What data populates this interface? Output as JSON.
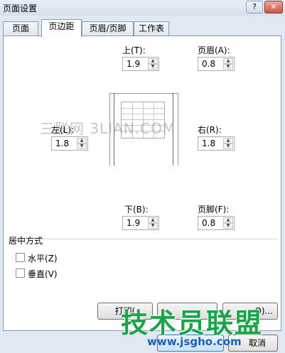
{
  "window": {
    "title": "页面设置",
    "help_label": "?",
    "close_label": "✕"
  },
  "tabs": [
    {
      "label": "页面"
    },
    {
      "label": "页边距",
      "active": true
    },
    {
      "label": "页眉/页脚"
    },
    {
      "label": "工作表"
    }
  ],
  "margins": {
    "top_label": "上(T):",
    "top_value": "1.9",
    "header_label": "页眉(A):",
    "header_value": "0.8",
    "left_label": "左(L):",
    "left_value": "1.8",
    "right_label": "右(R):",
    "right_value": "1.8",
    "bottom_label": "下(B):",
    "bottom_value": "1.9",
    "footer_label": "页脚(F):",
    "footer_value": "0.8"
  },
  "center": {
    "group_label": "居中方式",
    "horizontal_label": "水平(Z)",
    "horizontal_checked": false,
    "vertical_label": "垂直(V)",
    "vertical_checked": false
  },
  "buttons": {
    "print_label": "打印(",
    "options_label": "O)...",
    "cancel_label": "取消"
  },
  "watermarks": {
    "site_top": "三联网 3LIAN.COM",
    "brand": "技术员联盟",
    "url": "www.jsgho.com"
  },
  "colors": {
    "brand_green": "#19a548",
    "url_blue": "#1e5fb5"
  }
}
